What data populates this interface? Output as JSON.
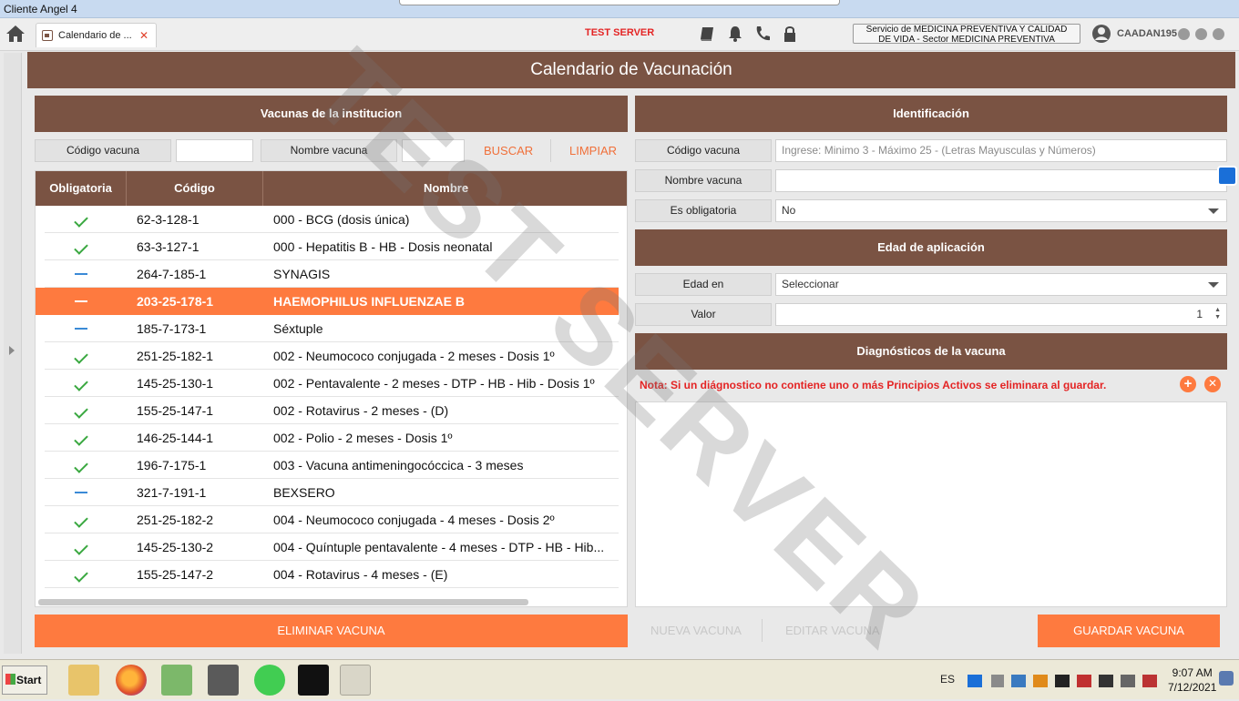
{
  "window": {
    "title": "Cliente Angel 4"
  },
  "topbar": {
    "tab_label": "Calendario de ...",
    "server_label": "TEST SERVER",
    "service_line1": "Servicio de MEDICINA PREVENTIVA Y CALIDAD",
    "service_line2": "DE VIDA - Sector MEDICINA PREVENTIVA",
    "username": "CAADAN195"
  },
  "page": {
    "title": "Calendario de Vacunación"
  },
  "left": {
    "section_title": "Vacunas de la institucion",
    "filter_code_label": "Código vacuna",
    "filter_code_value": "",
    "filter_name_label": "Nombre vacuna",
    "filter_name_value": "",
    "search_label": "BUSCAR",
    "clear_label": "LIMPIAR",
    "columns": [
      "Obligatoria",
      "Código",
      "Nombre"
    ],
    "rows": [
      {
        "mandatory": true,
        "code": "62-3-128-1",
        "name": "000 - BCG (dosis única)"
      },
      {
        "mandatory": true,
        "code": "63-3-127-1",
        "name": "000 - Hepatitis B -  HB -  Dosis neonatal"
      },
      {
        "mandatory": false,
        "code": "264-7-185-1",
        "name": "SYNAGIS"
      },
      {
        "mandatory": false,
        "code": "203-25-178-1",
        "name": "HAEMOPHILUS INFLUENZAE B",
        "selected": true
      },
      {
        "mandatory": false,
        "code": "185-7-173-1",
        "name": "Séxtuple"
      },
      {
        "mandatory": true,
        "code": "251-25-182-1",
        "name": "002 - Neumococo conjugada - 2 meses - Dosis 1º"
      },
      {
        "mandatory": true,
        "code": "145-25-130-1",
        "name": "002 - Pentavalente - 2 meses - DTP - HB - Hib - Dosis 1º"
      },
      {
        "mandatory": true,
        "code": "155-25-147-1",
        "name": "002 - Rotavirus - 2 meses - (D)"
      },
      {
        "mandatory": true,
        "code": "146-25-144-1",
        "name": "002 - Polio - 2 meses - Dosis 1º"
      },
      {
        "mandatory": true,
        "code": "196-7-175-1",
        "name": "003 - Vacuna antimeningocóccica - 3 meses"
      },
      {
        "mandatory": false,
        "code": "321-7-191-1",
        "name": "BEXSERO"
      },
      {
        "mandatory": true,
        "code": "251-25-182-2",
        "name": "004 - Neumococo conjugada - 4 meses - Dosis 2º"
      },
      {
        "mandatory": true,
        "code": "145-25-130-2",
        "name": "004 - Quíntuple pentavalente - 4 meses - DTP - HB - Hib..."
      },
      {
        "mandatory": true,
        "code": "155-25-147-2",
        "name": "004 - Rotavirus - 4 meses - (E)"
      }
    ],
    "delete_label": "ELIMINAR VACUNA"
  },
  "right": {
    "id_section_title": "Identificación",
    "code_label": "Código vacuna",
    "code_placeholder": "Ingrese: Minimo 3 - Máximo 25 - (Letras Mayusculas y Números)",
    "name_label": "Nombre vacuna",
    "name_value": "",
    "mandatory_label": "Es obligatoria",
    "mandatory_value": "No",
    "age_section_title": "Edad de aplicación",
    "age_unit_label": "Edad en",
    "age_unit_value": "Seleccionar",
    "value_label": "Valor",
    "value_value": "1",
    "diag_section_title": "Diagnósticos de la vacuna",
    "diag_note": "Nota: Si un diágnostico no contiene uno o más Principios Activos se eliminara al guardar.",
    "new_label": "NUEVA VACUNA",
    "edit_label": "EDITAR VACUNA",
    "save_label": "GUARDAR VACUNA"
  },
  "watermark": "TEST SERVER",
  "taskbar": {
    "start_label": "Start",
    "lang": "ES",
    "time": "9:07 AM",
    "date": "7/12/2021"
  },
  "colors": {
    "brown": "#7a5343",
    "orange": "#fe7a3f",
    "check": "#3aa840",
    "dash": "#3a8ad6",
    "server_red": "#e42424"
  }
}
